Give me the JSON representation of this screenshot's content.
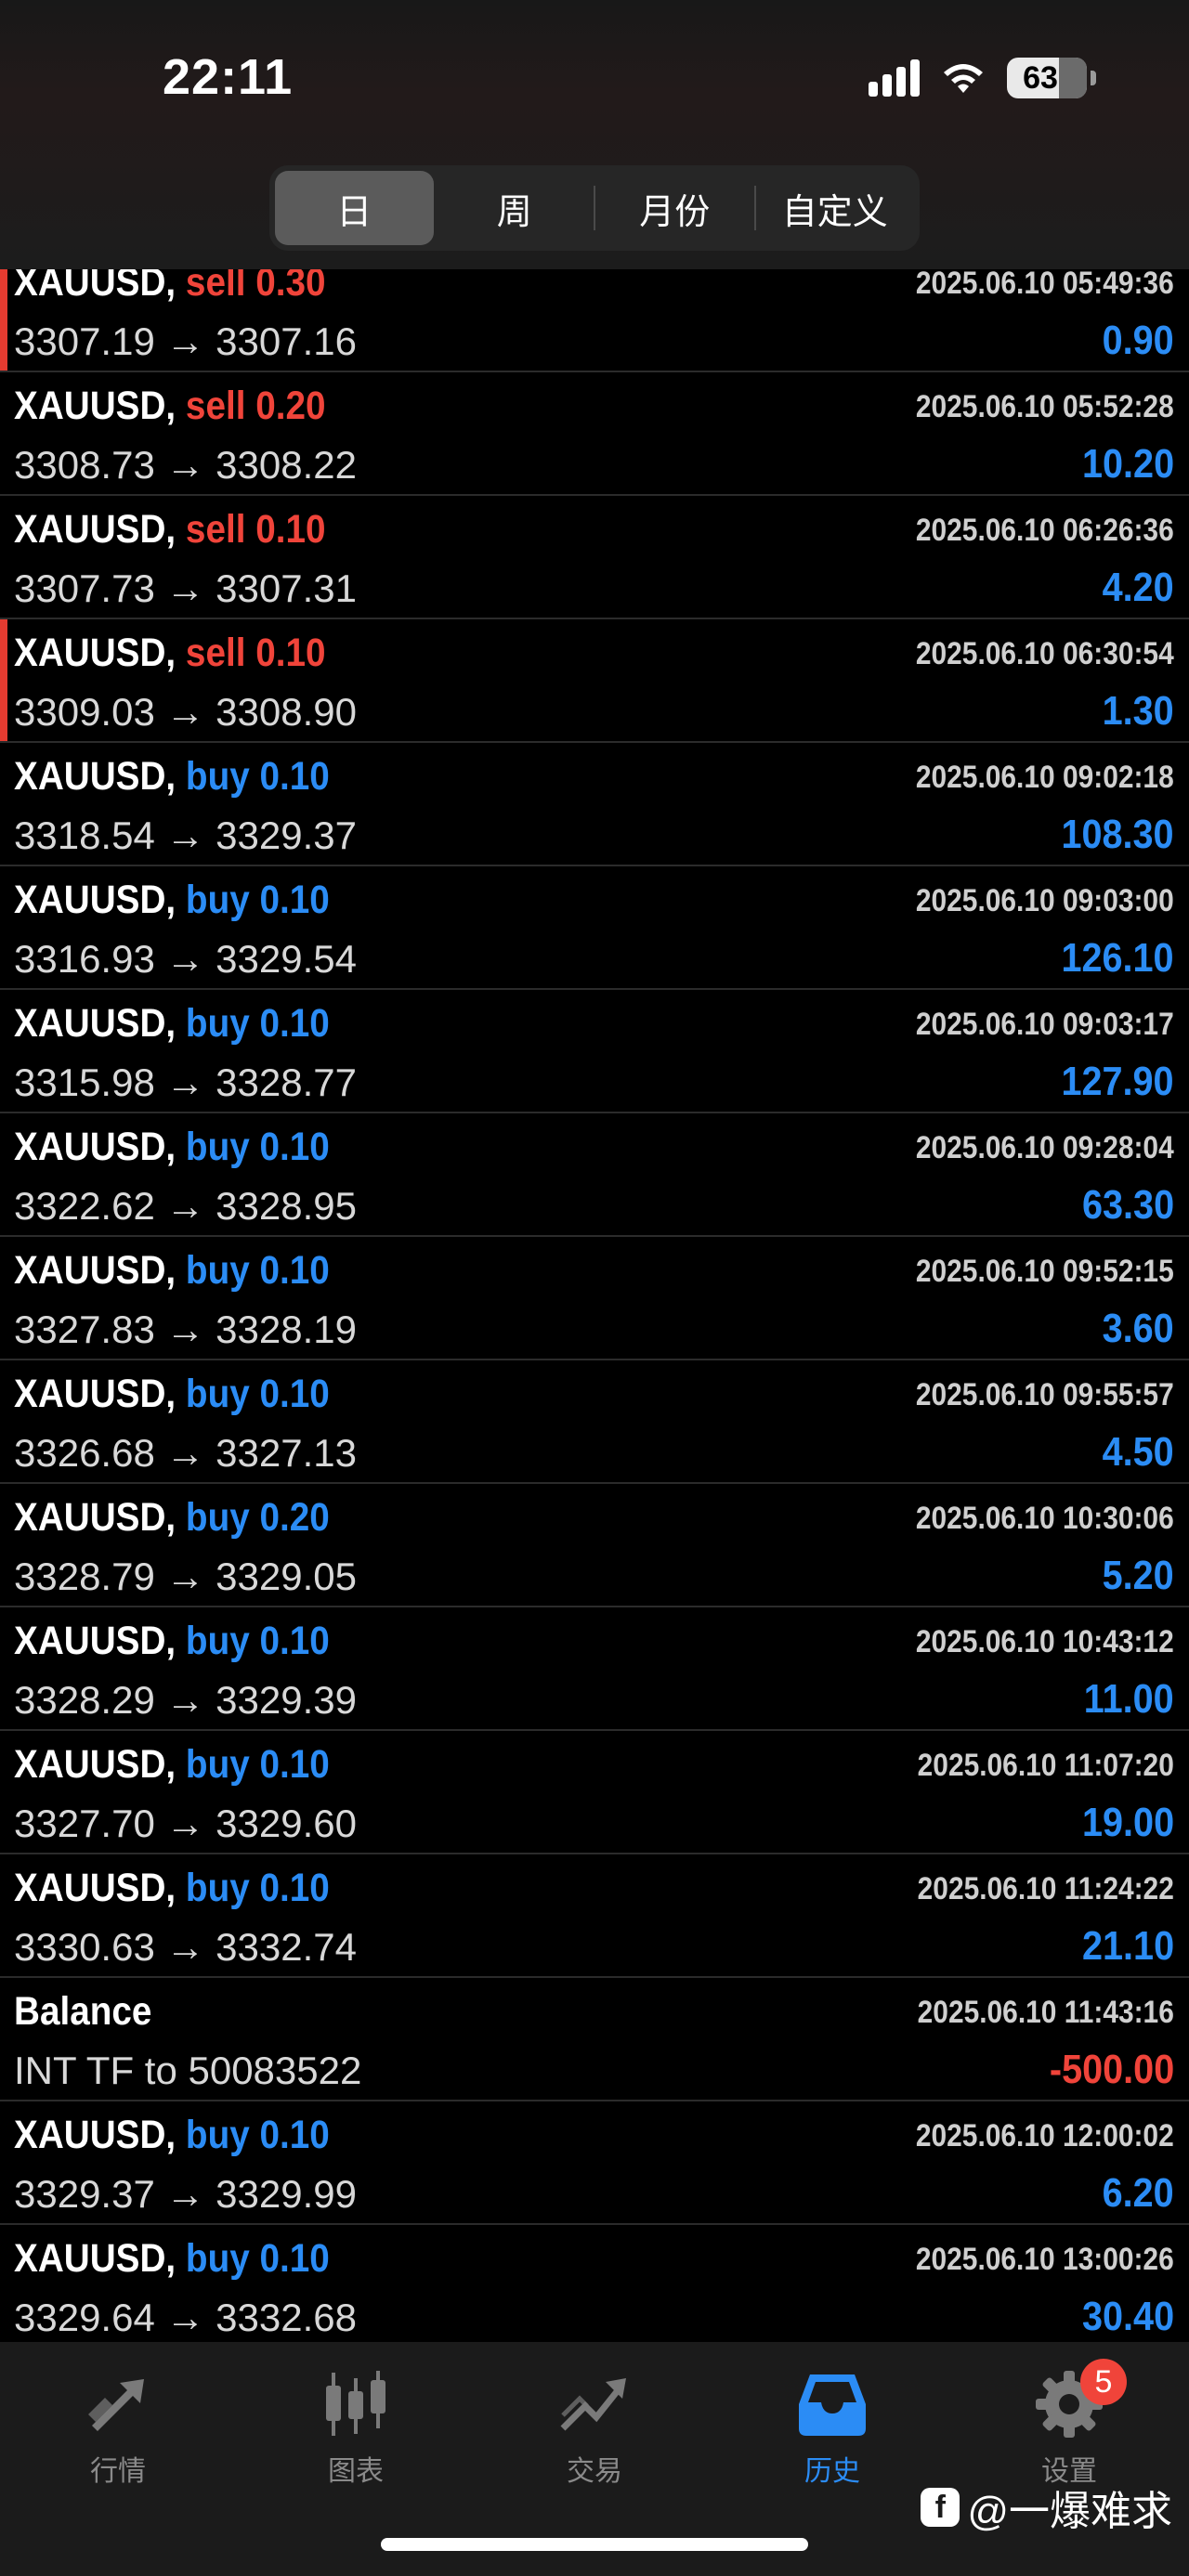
{
  "status_bar": {
    "time": "22:11",
    "battery": "63"
  },
  "period_tabs": [
    {
      "label": "日",
      "active": true
    },
    {
      "label": "周",
      "active": false
    },
    {
      "label": "月份",
      "active": false
    },
    {
      "label": "自定义",
      "active": false
    }
  ],
  "colors": {
    "sell": "#f0443a",
    "buy": "#2b8cf5",
    "background": "#000000"
  },
  "trades": [
    {
      "symbol": "XAUUSD,",
      "side": "sell",
      "lot": "0.30",
      "datetime": "2025.06.10 05:49:36",
      "open_price": "3307.19",
      "close_price": "3307.16",
      "profit": "0.90",
      "marked": true
    },
    {
      "symbol": "XAUUSD,",
      "side": "sell",
      "lot": "0.20",
      "datetime": "2025.06.10 05:52:28",
      "open_price": "3308.73",
      "close_price": "3308.22",
      "profit": "10.20",
      "marked": false
    },
    {
      "symbol": "XAUUSD,",
      "side": "sell",
      "lot": "0.10",
      "datetime": "2025.06.10 06:26:36",
      "open_price": "3307.73",
      "close_price": "3307.31",
      "profit": "4.20",
      "marked": false
    },
    {
      "symbol": "XAUUSD,",
      "side": "sell",
      "lot": "0.10",
      "datetime": "2025.06.10 06:30:54",
      "open_price": "3309.03",
      "close_price": "3308.90",
      "profit": "1.30",
      "marked": true
    },
    {
      "symbol": "XAUUSD,",
      "side": "buy",
      "lot": "0.10",
      "datetime": "2025.06.10 09:02:18",
      "open_price": "3318.54",
      "close_price": "3329.37",
      "profit": "108.30",
      "marked": false
    },
    {
      "symbol": "XAUUSD,",
      "side": "buy",
      "lot": "0.10",
      "datetime": "2025.06.10 09:03:00",
      "open_price": "3316.93",
      "close_price": "3329.54",
      "profit": "126.10",
      "marked": false
    },
    {
      "symbol": "XAUUSD,",
      "side": "buy",
      "lot": "0.10",
      "datetime": "2025.06.10 09:03:17",
      "open_price": "3315.98",
      "close_price": "3328.77",
      "profit": "127.90",
      "marked": false
    },
    {
      "symbol": "XAUUSD,",
      "side": "buy",
      "lot": "0.10",
      "datetime": "2025.06.10 09:28:04",
      "open_price": "3322.62",
      "close_price": "3328.95",
      "profit": "63.30",
      "marked": false
    },
    {
      "symbol": "XAUUSD,",
      "side": "buy",
      "lot": "0.10",
      "datetime": "2025.06.10 09:52:15",
      "open_price": "3327.83",
      "close_price": "3328.19",
      "profit": "3.60",
      "marked": false
    },
    {
      "symbol": "XAUUSD,",
      "side": "buy",
      "lot": "0.10",
      "datetime": "2025.06.10 09:55:57",
      "open_price": "3326.68",
      "close_price": "3327.13",
      "profit": "4.50",
      "marked": false
    },
    {
      "symbol": "XAUUSD,",
      "side": "buy",
      "lot": "0.20",
      "datetime": "2025.06.10 10:30:06",
      "open_price": "3328.79",
      "close_price": "3329.05",
      "profit": "5.20",
      "marked": false
    },
    {
      "symbol": "XAUUSD,",
      "side": "buy",
      "lot": "0.10",
      "datetime": "2025.06.10 10:43:12",
      "open_price": "3328.29",
      "close_price": "3329.39",
      "profit": "11.00",
      "marked": false
    },
    {
      "symbol": "XAUUSD,",
      "side": "buy",
      "lot": "0.10",
      "datetime": "2025.06.10 11:07:20",
      "open_price": "3327.70",
      "close_price": "3329.60",
      "profit": "19.00",
      "marked": false
    },
    {
      "symbol": "XAUUSD,",
      "side": "buy",
      "lot": "0.10",
      "datetime": "2025.06.10 11:24:22",
      "open_price": "3330.63",
      "close_price": "3332.74",
      "profit": "21.10",
      "marked": false
    },
    {
      "type": "balance",
      "title": "Balance",
      "datetime": "2025.06.10 11:43:16",
      "description": "INT TF to 50083522",
      "profit": "-500.00",
      "marked": false
    },
    {
      "symbol": "XAUUSD,",
      "side": "buy",
      "lot": "0.10",
      "datetime": "2025.06.10 12:00:02",
      "open_price": "3329.37",
      "close_price": "3329.99",
      "profit": "6.20",
      "marked": false
    },
    {
      "symbol": "XAUUSD,",
      "side": "buy",
      "lot": "0.10",
      "datetime": "2025.06.10 13:00:26",
      "open_price": "3329.64",
      "close_price": "3332.68",
      "profit": "30.40",
      "marked": false
    }
  ],
  "tab_bar": [
    {
      "label": "行情",
      "icon": "quotes-arrows-icon",
      "active": false
    },
    {
      "label": "图表",
      "icon": "candlestick-chart-icon",
      "active": false
    },
    {
      "label": "交易",
      "icon": "trade-trend-icon",
      "active": false
    },
    {
      "label": "历史",
      "icon": "history-inbox-icon",
      "active": true
    },
    {
      "label": "设置",
      "icon": "settings-gear-icon",
      "active": false,
      "badge": "5"
    }
  ],
  "watermark": {
    "text": "@一爆难求",
    "logo": "f"
  },
  "arrow": "→"
}
